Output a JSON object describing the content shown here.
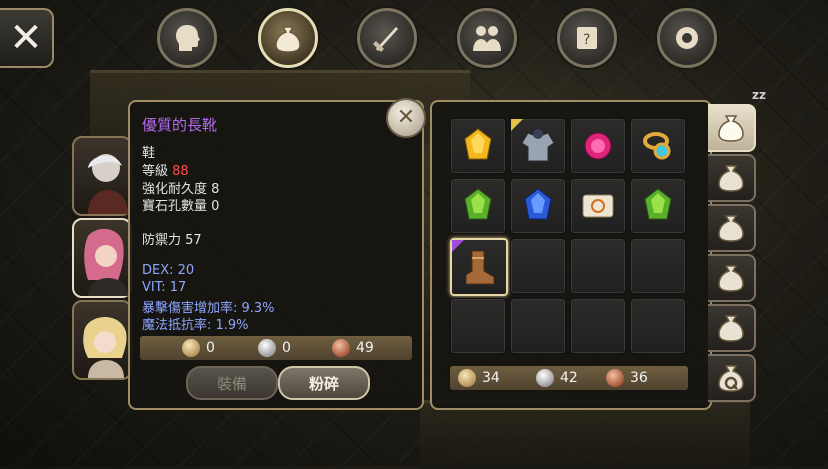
{
  "top_tabs": [
    {
      "icon": "head-icon",
      "active": false
    },
    {
      "icon": "bag-icon",
      "active": true
    },
    {
      "icon": "skill-icon",
      "active": false
    },
    {
      "icon": "party-icon",
      "active": false
    },
    {
      "icon": "quest-scroll-icon",
      "active": false
    },
    {
      "icon": "gear-icon",
      "active": false
    }
  ],
  "close_glyph": "✕",
  "detail": {
    "item_name": "優質的長靴",
    "item_type": "鞋",
    "level_label": "等級",
    "level_value": "88",
    "durability": "強化耐久度 8",
    "gem_slots": "寶石孔數量 0",
    "defense": "防禦力 57",
    "dex": "DEX: 20",
    "vit": "VIT: 17",
    "crit_damage": "暴擊傷害增加率: 9.3%",
    "magic_resist": "魔法抵抗率: 1.9%",
    "price": {
      "gold": "0",
      "silver": "0",
      "copper": "49"
    },
    "equip_button": "裝備",
    "smash_button": "粉碎"
  },
  "inventory": {
    "slots": [
      {
        "icon": "topaz-gem-icon"
      },
      {
        "icon": "armor-icon"
      },
      {
        "icon": "ruby-gem-icon"
      },
      {
        "icon": "gold-ring-icon"
      },
      {
        "icon": "emerald-gem-icon"
      },
      {
        "icon": "sapphire-gem-icon"
      },
      {
        "icon": "scroll-map-icon"
      },
      {
        "icon": "emerald-gem-icon"
      },
      {
        "icon": "boots-icon"
      },
      {
        "icon": ""
      },
      {
        "icon": ""
      },
      {
        "icon": ""
      },
      {
        "icon": ""
      },
      {
        "icon": ""
      },
      {
        "icon": ""
      },
      {
        "icon": ""
      }
    ],
    "coins": {
      "gold": "34",
      "silver": "42",
      "copper": "36"
    }
  },
  "bag_tabs": [
    {
      "icon": "bag-icon",
      "active": true
    },
    {
      "icon": "bag-icon",
      "active": false
    },
    {
      "icon": "bag-icon",
      "active": false
    },
    {
      "icon": "bag-icon",
      "active": false
    },
    {
      "icon": "bag-icon",
      "active": false
    },
    {
      "icon": "quest-bag-icon",
      "active": false
    }
  ],
  "colors": {
    "accent": "#a08d65",
    "item_name": "#b46cf0",
    "level": "#ff4a4a",
    "stat_blue": "#8ea6ff"
  },
  "bg_text": "zz"
}
